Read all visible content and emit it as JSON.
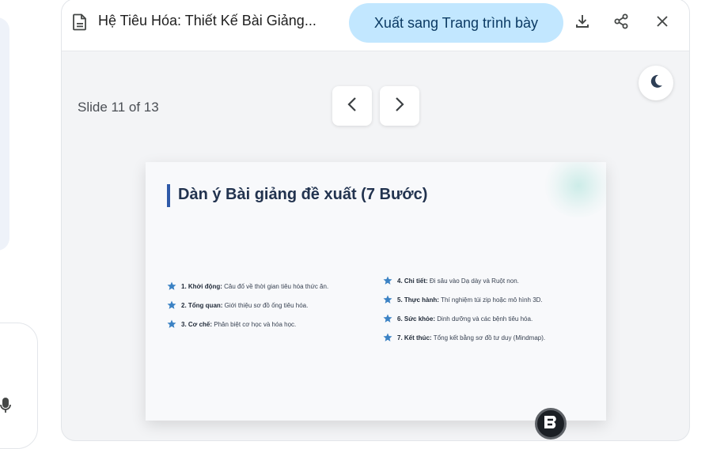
{
  "header": {
    "title": "Hệ Tiêu Hóa: Thiết Kế Bài Giảng...",
    "export_label": "Xuất sang Trang trình bày",
    "icons": [
      "document-icon",
      "download-icon",
      "share-icon",
      "close-icon"
    ]
  },
  "viewer": {
    "slide_counter": "Slide 11 of 13",
    "icons": [
      "chevron-left-icon",
      "chevron-right-icon",
      "moon-icon"
    ]
  },
  "slide": {
    "title": "Dàn ý Bài giảng đề xuất (7 Bước)",
    "left_items": [
      {
        "label": "1. Khởi động:",
        "text": "Câu đố về thời gian tiêu hóa thức ăn."
      },
      {
        "label": "2. Tổng quan:",
        "text": "Giới thiệu sơ đồ ống tiêu hóa."
      },
      {
        "label": "3. Cơ chế:",
        "text": "Phân biệt cơ học và hóa học."
      }
    ],
    "right_items": [
      {
        "label": "4. Chi tiết:",
        "text": "Đi sâu vào Dạ dày và Ruột non."
      },
      {
        "label": "5. Thực hành:",
        "text": "Thí nghiệm túi zip hoặc mô hình 3D."
      },
      {
        "label": "6. Sức khỏe:",
        "text": "Dinh dưỡng và các bệnh tiêu hóa."
      },
      {
        "label": "7. Kết thúc:",
        "text": "Tổng kết bằng sơ đồ tư duy (Mindmap)."
      }
    ],
    "star_color": "#3b82c4"
  },
  "colors": {
    "accent_button": "#c2e7ff",
    "title_bar": "#2f5aa8"
  }
}
